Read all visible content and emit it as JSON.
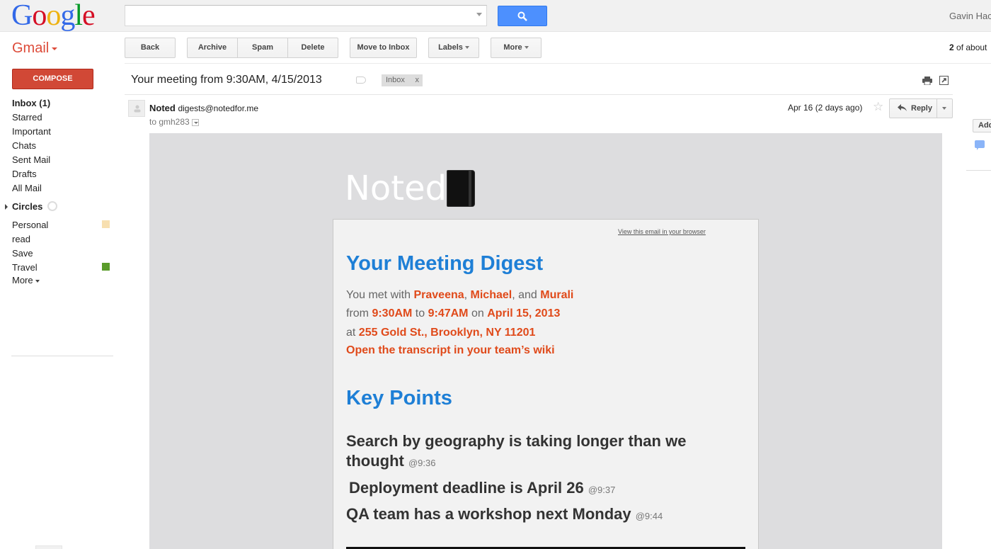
{
  "logo": {
    "letters": [
      "G",
      "o",
      "o",
      "g",
      "l",
      "e"
    ]
  },
  "search": {
    "placeholder": ""
  },
  "user": {
    "name": "Gavin Hac"
  },
  "app": {
    "label": "Gmail"
  },
  "toolbar": {
    "back": "Back",
    "archive": "Archive",
    "spam": "Spam",
    "delete": "Delete",
    "move_to_inbox": "Move to Inbox",
    "labels": "Labels",
    "more": "More",
    "pager_count": "2",
    "pager_rest": " of about"
  },
  "sidebar": {
    "compose": "COMPOSE",
    "items": [
      {
        "label": "Inbox (1)"
      },
      {
        "label": "Starred"
      },
      {
        "label": "Important"
      },
      {
        "label": "Chats"
      },
      {
        "label": "Sent Mail"
      },
      {
        "label": "Drafts"
      },
      {
        "label": "All Mail"
      }
    ],
    "circles": "Circles",
    "labels": [
      {
        "label": "Personal",
        "color": "#f7dfb0"
      },
      {
        "label": "read"
      },
      {
        "label": "Save"
      },
      {
        "label": "Travel",
        "color": "#5a9c2a"
      }
    ],
    "more": "More"
  },
  "thread": {
    "subject": "Your meeting from 9:30AM, 4/15/2013",
    "chip_label": "Inbox",
    "chip_close": "x"
  },
  "message": {
    "sender_name": "Noted",
    "sender_email": "digests@notedfor.me",
    "recipient": "to gmh283",
    "date": "Apr 16 (2 days ago)",
    "star": "☆",
    "reply": "Reply"
  },
  "right_panel": {
    "add": "Add"
  },
  "email": {
    "logo_text": "Noted",
    "view_in_browser": "View this email in your browser",
    "title": "Your Meeting Digest",
    "met_prefix": "You met with ",
    "person1": "Praveena",
    "sep1": ", ",
    "person2": "Michael",
    "sep2": ", and ",
    "person3": "Murali",
    "from_prefix": "from ",
    "start_time": "9:30AM",
    "to_word": " to ",
    "end_time": "9:47AM",
    "on_word": " on ",
    "date": "April 15, 2013",
    "at_prefix": "at ",
    "address": "255 Gold St., Brooklyn, NY 11201",
    "transcript_link": "Open the transcript in your team’s wiki",
    "key_points_title": "Key Points",
    "key_points": [
      {
        "line1": "Search by geography is taking longer than we",
        "line2": "thought",
        "time": "@9:36"
      },
      {
        "text": "Deployment deadline is April 26",
        "time": "@9:37"
      },
      {
        "text": "QA team has a workshop next Monday",
        "time": "@9:44"
      }
    ]
  },
  "colors": {
    "accent_blue": "#1e7fd6",
    "accent_orange": "#e04a1a",
    "compose_red": "#d14836",
    "search_blue": "#4d90fe"
  }
}
